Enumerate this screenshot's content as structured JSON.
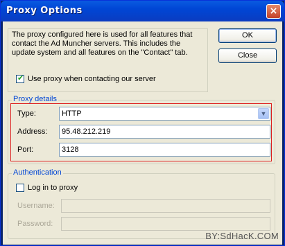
{
  "window": {
    "title": "Proxy Options",
    "close_glyph": "×"
  },
  "buttons": {
    "ok": "OK",
    "close": "Close"
  },
  "info": {
    "text": "The proxy configured here is used for all features that contact the Ad Muncher servers. This includes the update system and all features on the \"Contact\" tab.",
    "use_proxy_label": "Use proxy when contacting our server",
    "use_proxy_checked": true
  },
  "proxy_details": {
    "title": "Proxy details",
    "type_label": "Type:",
    "type_value": "HTTP",
    "address_label": "Address:",
    "address_value": "95.48.212.219",
    "port_label": "Port:",
    "port_value": "3128"
  },
  "authentication": {
    "title": "Authentication",
    "login_label": "Log in to proxy",
    "login_checked": false,
    "username_label": "Username:",
    "username_value": "",
    "password_label": "Password:",
    "password_value": ""
  },
  "watermark": "BY:SdHacK.COM",
  "colors": {
    "title_bar": "#0046d5",
    "group_title": "#0046d5",
    "highlight_box": "#dd2222",
    "check_mark": "#21a121"
  },
  "icons": {
    "close": "close-icon",
    "dropdown": "chevron-down-icon",
    "check": "checkmark-icon"
  }
}
